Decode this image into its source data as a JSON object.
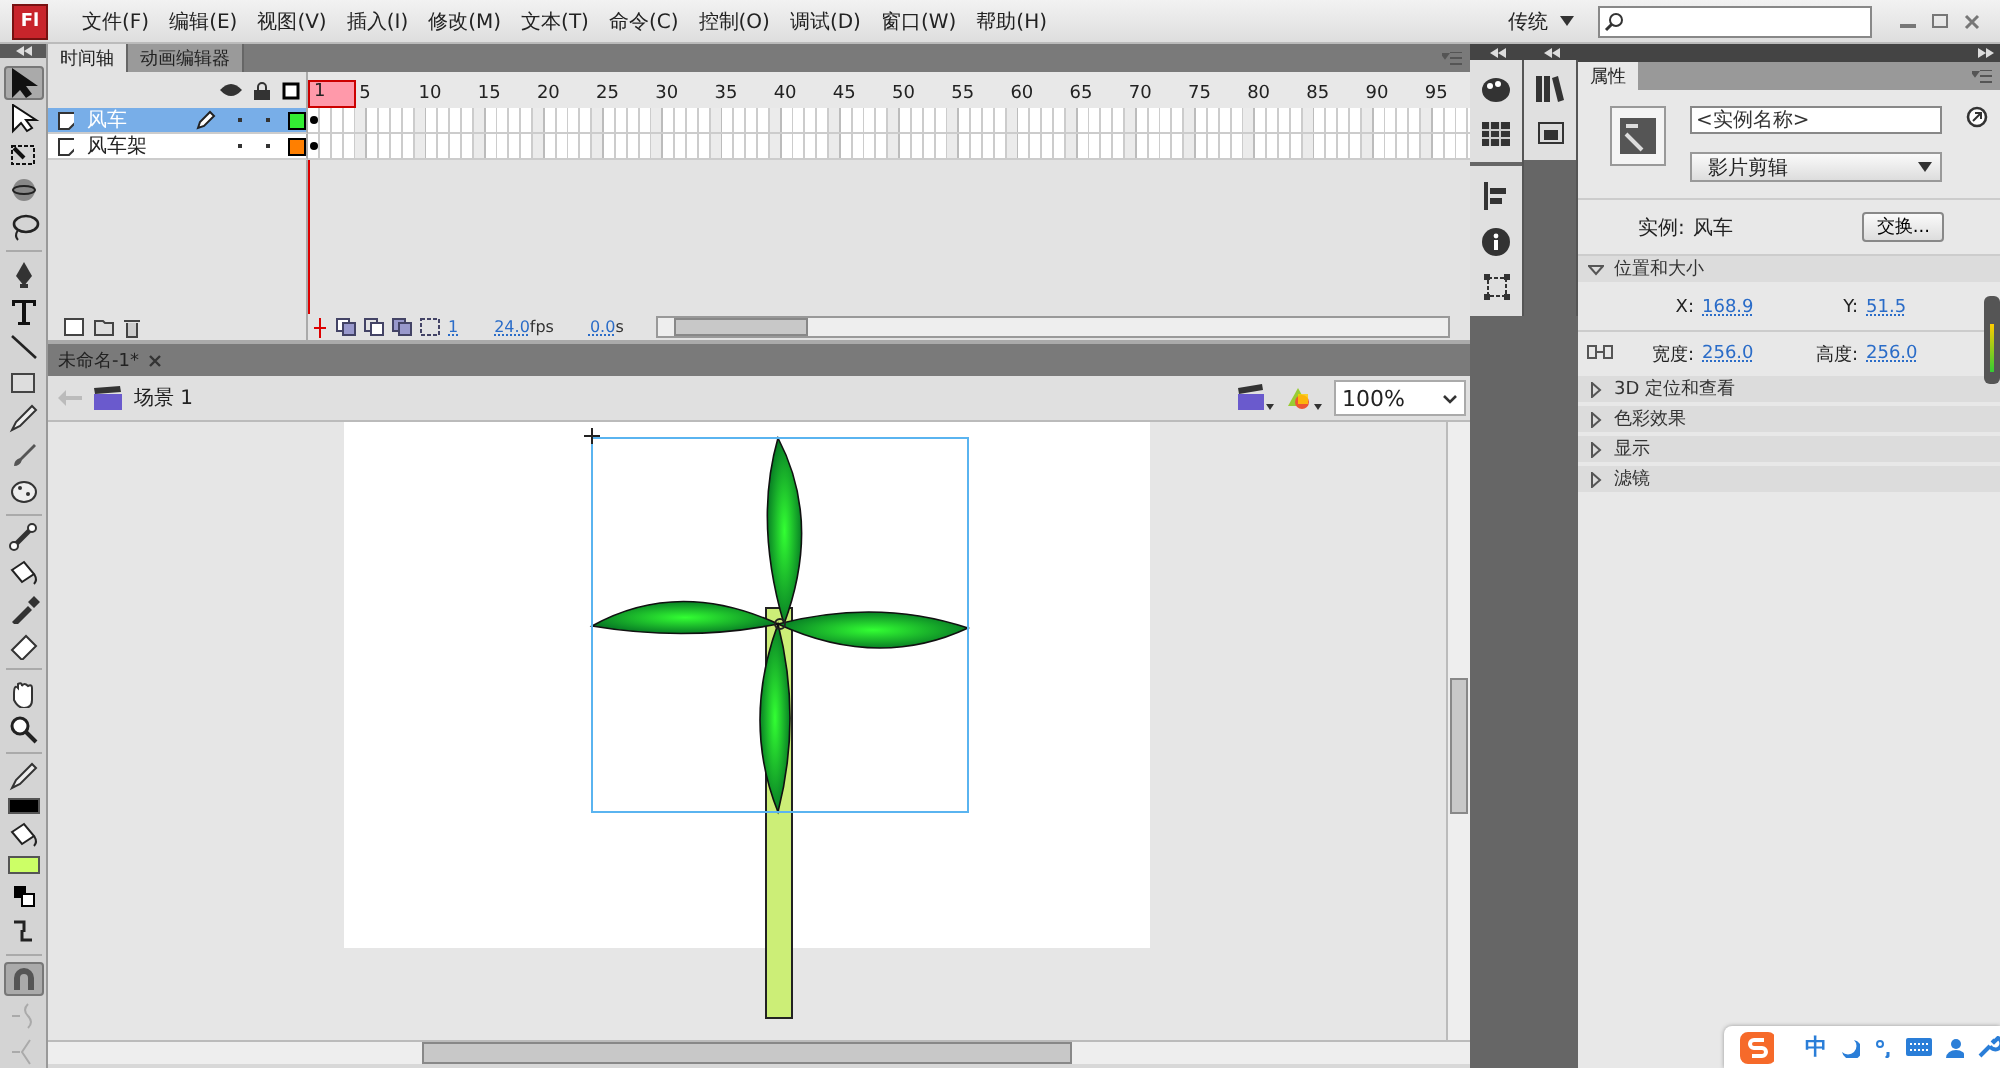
{
  "app": {
    "logo": "Fl"
  },
  "menu": [
    "文件(F)",
    "编辑(E)",
    "视图(V)",
    "插入(I)",
    "修改(M)",
    "文本(T)",
    "命令(C)",
    "控制(O)",
    "调试(D)",
    "窗口(W)",
    "帮助(H)"
  ],
  "workspace": {
    "label": "传统"
  },
  "tool_groups": [
    [
      {
        "kind": "arrow",
        "selected": true
      },
      {
        "kind": "subselect",
        "selected": false
      },
      {
        "kind": "transform",
        "selected": false
      },
      {
        "kind": "rotate3d",
        "selected": false
      },
      {
        "kind": "lasso",
        "selected": false
      }
    ],
    [
      {
        "kind": "pen",
        "selected": false
      },
      {
        "kind": "text",
        "selected": false
      },
      {
        "kind": "line",
        "selected": false
      },
      {
        "kind": "rect",
        "selected": false
      },
      {
        "kind": "pencil",
        "selected": false
      },
      {
        "kind": "brush",
        "selected": false
      },
      {
        "kind": "deco",
        "selected": false
      }
    ],
    [
      {
        "kind": "bone",
        "selected": false
      },
      {
        "kind": "bucket",
        "selected": false
      },
      {
        "kind": "eyedropper",
        "selected": false
      },
      {
        "kind": "eraser",
        "selected": false
      }
    ],
    [
      {
        "kind": "hand",
        "selected": false
      },
      {
        "kind": "zoom",
        "selected": false
      }
    ],
    [
      {
        "kind": "pencil",
        "selected": false
      },
      {
        "kind": "swatch",
        "color": "#000000"
      },
      {
        "kind": "bucket",
        "selected": false
      },
      {
        "kind": "swatch",
        "color": "#ccff66"
      },
      {
        "kind": "defaults",
        "selected": false
      },
      {
        "kind": "swap",
        "selected": false
      }
    ],
    [
      {
        "kind": "magnet",
        "selected": true
      },
      {
        "kind": "smooth",
        "selected": false
      },
      {
        "kind": "straighten",
        "selected": false
      }
    ]
  ],
  "timeline": {
    "tabs": [
      {
        "label": "时间轴",
        "selected": true
      },
      {
        "label": "动画编辑器",
        "selected": false
      }
    ],
    "frame_numbers": [
      "1",
      "5",
      "10",
      "15",
      "20",
      "25",
      "30",
      "35",
      "40",
      "45",
      "50",
      "55",
      "60",
      "65",
      "70",
      "75",
      "80",
      "85",
      "90",
      "95"
    ],
    "layers": [
      {
        "name": "风车",
        "selected": true,
        "editing": true,
        "color": "#33ee33"
      },
      {
        "name": "风车架",
        "selected": false,
        "editing": false,
        "color": "#ff7f00"
      }
    ],
    "current_frame": "1",
    "fps": "24.0",
    "fps_unit": "fps",
    "time": "0.0",
    "time_unit": "s"
  },
  "document": {
    "tabs": [
      {
        "label": "未命名-1*",
        "selected": true
      }
    ],
    "scene": "场景 1",
    "zoom": "100%"
  },
  "properties": {
    "tab": "属性",
    "instance_name_placeholder": "<实例名称>",
    "symbol_type": "影片剪辑",
    "instance_label": "实例:",
    "instance_value": "风车",
    "swap_button": "交换...",
    "sections": [
      {
        "label": "位置和大小",
        "expanded": true,
        "rows": [
          {
            "linked": false,
            "fields": [
              {
                "label": "X:",
                "value": "168.9"
              },
              {
                "label": "Y:",
                "value": "51.5"
              }
            ]
          },
          {
            "linked": true,
            "fields": [
              {
                "label": "宽度:",
                "value": "256.0"
              },
              {
                "label": "高度:",
                "value": "256.0"
              }
            ]
          }
        ]
      },
      {
        "label": "3D 定位和查看",
        "expanded": false
      },
      {
        "label": "色彩效果",
        "expanded": false
      },
      {
        "label": "显示",
        "expanded": false
      },
      {
        "label": "滤镜",
        "expanded": false
      }
    ]
  },
  "ime": {
    "label": "中"
  }
}
